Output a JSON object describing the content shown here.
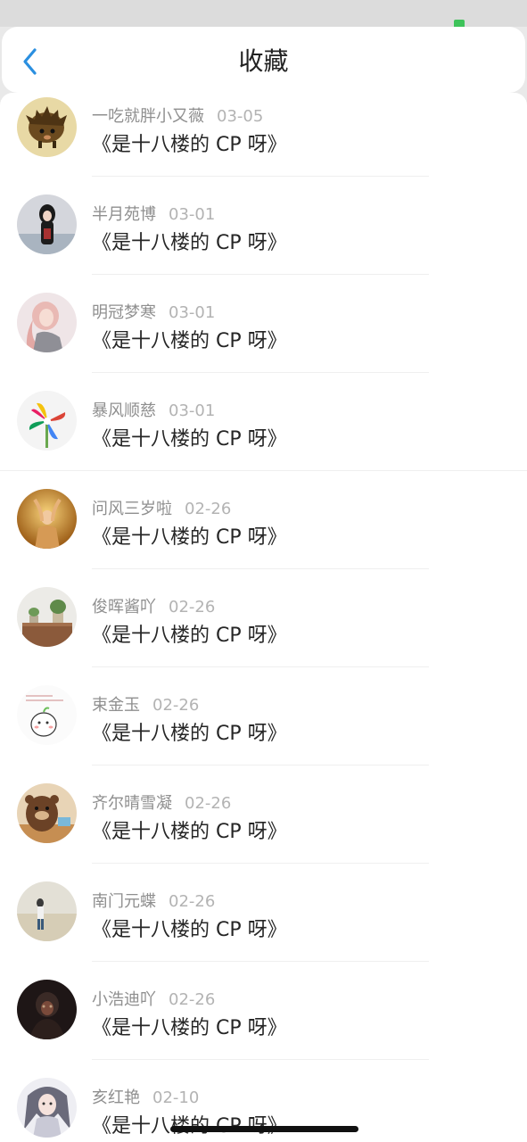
{
  "header": {
    "title": "收藏"
  },
  "items": [
    {
      "user": "一吃就胖小又薇",
      "date": "03-05",
      "title": "《是十八楼的 CP 呀》",
      "avatar_icon": "avatar-hedgehog-icon",
      "avatar_color": "#c9a24a"
    },
    {
      "user": "半月苑博",
      "date": "03-01",
      "title": "《是十八楼的 CP 呀》",
      "avatar_icon": "avatar-girl-dark-hair-icon",
      "avatar_color": "#cfcfd4"
    },
    {
      "user": "明冠梦寒",
      "date": "03-01",
      "title": "《是十八楼的 CP 呀》",
      "avatar_icon": "avatar-girl-pink-hair-icon",
      "avatar_color": "#e7c7c7"
    },
    {
      "user": "暴风顺慈",
      "date": "03-01",
      "title": "《是十八楼的 CP 呀》",
      "avatar_icon": "avatar-pinwheel-icon",
      "avatar_color": "#f2f2f2"
    },
    {
      "user": "问风三岁啦",
      "date": "02-26",
      "title": "《是十八楼的 CP 呀》",
      "avatar_icon": "avatar-girl-sunset-icon",
      "avatar_color": "#c98a2a"
    },
    {
      "user": "俊晖酱吖",
      "date": "02-26",
      "title": "《是十八楼的 CP 呀》",
      "avatar_icon": "avatar-plants-table-icon",
      "avatar_color": "#e6e4df"
    },
    {
      "user": "束金玉",
      "date": "02-26",
      "title": "《是十八楼的 CP 呀》",
      "avatar_icon": "avatar-cartoon-doodle-icon",
      "avatar_color": "#fbfbfb"
    },
    {
      "user": "齐尔晴雪凝",
      "date": "02-26",
      "title": "《是十八楼的 CP 呀》",
      "avatar_icon": "avatar-bear-icon",
      "avatar_color": "#8a5a3a"
    },
    {
      "user": "南门元蝶",
      "date": "02-26",
      "title": "《是十八楼的 CP 呀》",
      "avatar_icon": "avatar-beach-person-icon",
      "avatar_color": "#d9d4c6"
    },
    {
      "user": "小浩迪吖",
      "date": "02-26",
      "title": "《是十八楼的 CP 呀》",
      "avatar_icon": "avatar-dark-figure-icon",
      "avatar_color": "#2a2020"
    },
    {
      "user": "亥红艳",
      "date": "02-10",
      "title": "《是十八楼的 CP 呀》",
      "avatar_icon": "avatar-anime-character-icon",
      "avatar_color": "#e7e7ee"
    }
  ]
}
